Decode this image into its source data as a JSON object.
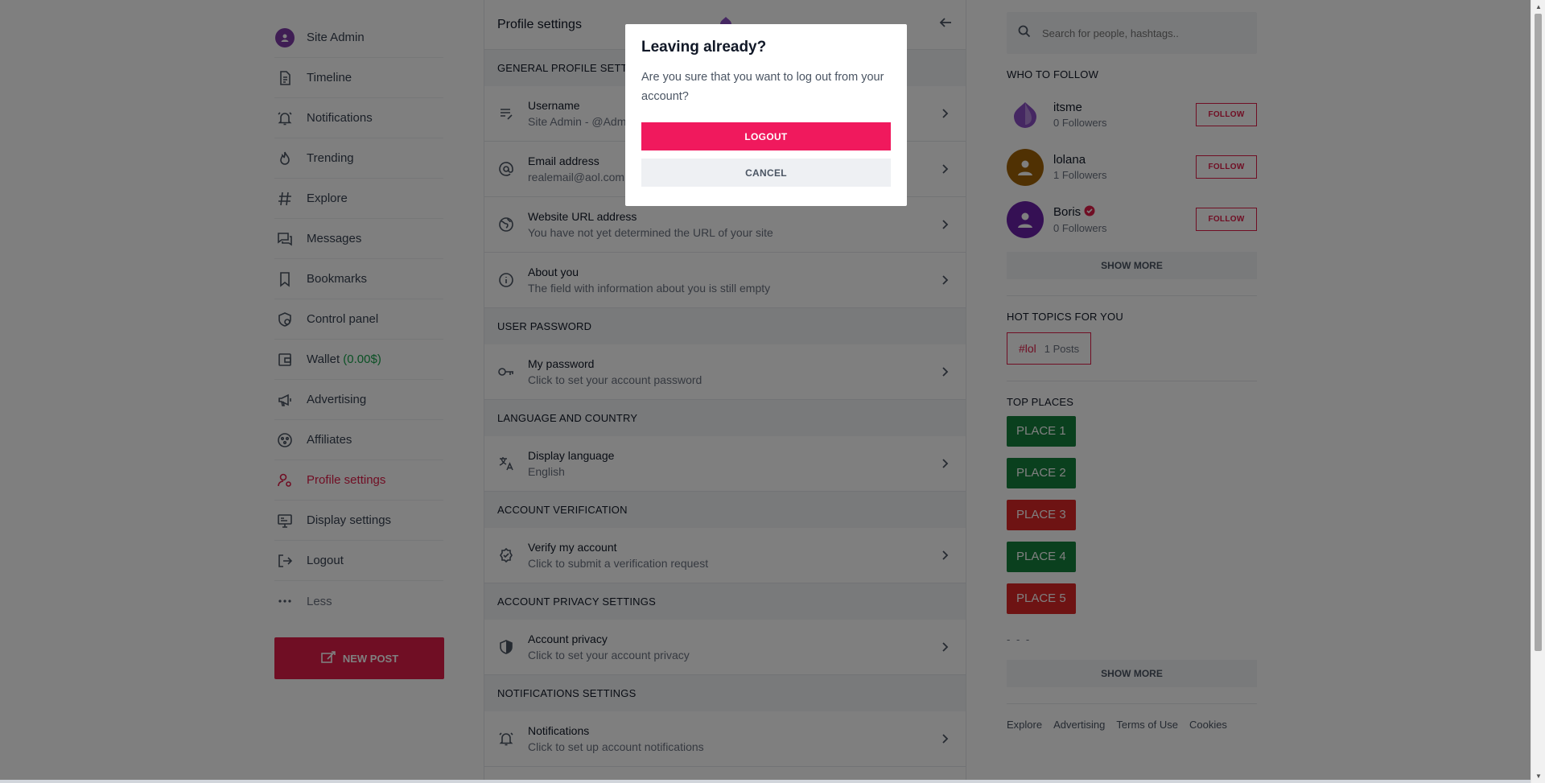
{
  "colors": {
    "accent": "#e11d48",
    "logout": "#f0195d",
    "wallet": "#16a34a",
    "place_green": "#15803d",
    "place_red": "#dc2626"
  },
  "sidebar": {
    "items": [
      {
        "label": "Site Admin",
        "icon": "avatar-icon"
      },
      {
        "label": "Timeline",
        "icon": "timeline-icon"
      },
      {
        "label": "Notifications",
        "icon": "bell-icon"
      },
      {
        "label": "Trending",
        "icon": "flame-icon"
      },
      {
        "label": "Explore",
        "icon": "hash-icon"
      },
      {
        "label": "Messages",
        "icon": "chat-icon"
      },
      {
        "label": "Bookmarks",
        "icon": "bookmark-icon"
      },
      {
        "label": "Control panel",
        "icon": "control-panel-icon"
      },
      {
        "label": "Wallet",
        "amount": "(0.00$)",
        "icon": "wallet-icon"
      },
      {
        "label": "Advertising",
        "icon": "megaphone-icon"
      },
      {
        "label": "Affiliates",
        "icon": "affiliates-icon"
      },
      {
        "label": "Profile settings",
        "icon": "user-settings-icon"
      },
      {
        "label": "Display settings",
        "icon": "display-icon"
      },
      {
        "label": "Logout",
        "icon": "logout-icon"
      },
      {
        "label": "Less",
        "icon": "more-dots-icon"
      }
    ],
    "new_post": "NEW POST"
  },
  "main": {
    "title": "Profile settings",
    "sections": [
      {
        "title": "GENERAL PROFILE SETTINGS",
        "rows": [
          {
            "title": "Username",
            "subtitle": "Site Admin - @Admin"
          },
          {
            "title": "Email address",
            "subtitle": "realemail@aol.com"
          },
          {
            "title": "Website URL address",
            "subtitle": "You have not yet determined the URL of your site"
          },
          {
            "title": "About you",
            "subtitle": "The field with information about you is still empty"
          }
        ]
      },
      {
        "title": "USER PASSWORD",
        "rows": [
          {
            "title": "My password",
            "subtitle": "Click to set your account password"
          }
        ]
      },
      {
        "title": "LANGUAGE AND COUNTRY",
        "rows": [
          {
            "title": "Display language",
            "subtitle": "English"
          }
        ]
      },
      {
        "title": "ACCOUNT VERIFICATION",
        "rows": [
          {
            "title": "Verify my account",
            "subtitle": "Click to submit a verification request"
          }
        ]
      },
      {
        "title": "ACCOUNT PRIVACY SETTINGS",
        "rows": [
          {
            "title": "Account privacy",
            "subtitle": "Click to set your account privacy"
          }
        ]
      },
      {
        "title": "NOTIFICATIONS SETTINGS",
        "rows": [
          {
            "title": "Notifications",
            "subtitle": "Click to set up account notifications"
          }
        ]
      }
    ]
  },
  "right": {
    "search_placeholder": "Search for people, hashtags..",
    "who_to_follow_title": "WHO TO FOLLOW",
    "follow": [
      {
        "name": "itsme",
        "followers": "0 Followers"
      },
      {
        "name": "lolana",
        "followers": "1 Followers"
      },
      {
        "name": "Boris",
        "followers": "0 Followers"
      }
    ],
    "follow_label": "FOLLOW",
    "show_more": "SHOW MORE",
    "hot_topics_title": "HOT TOPICS FOR YOU",
    "hashtag": {
      "tag": "#lol",
      "posts": "1 Posts"
    },
    "top_places_title": "TOP PLACES",
    "places": [
      "PLACE 1",
      "PLACE 2",
      "PLACE 3",
      "PLACE 4",
      "PLACE 5"
    ],
    "ellipsis": "- - -",
    "footer": [
      "Explore",
      "Advertising",
      "Terms of Use",
      "Cookies"
    ]
  },
  "modal": {
    "title": "Leaving already?",
    "message": "Are you sure that you want to log out from your account?",
    "logout": "LOGOUT",
    "cancel": "CANCEL"
  }
}
